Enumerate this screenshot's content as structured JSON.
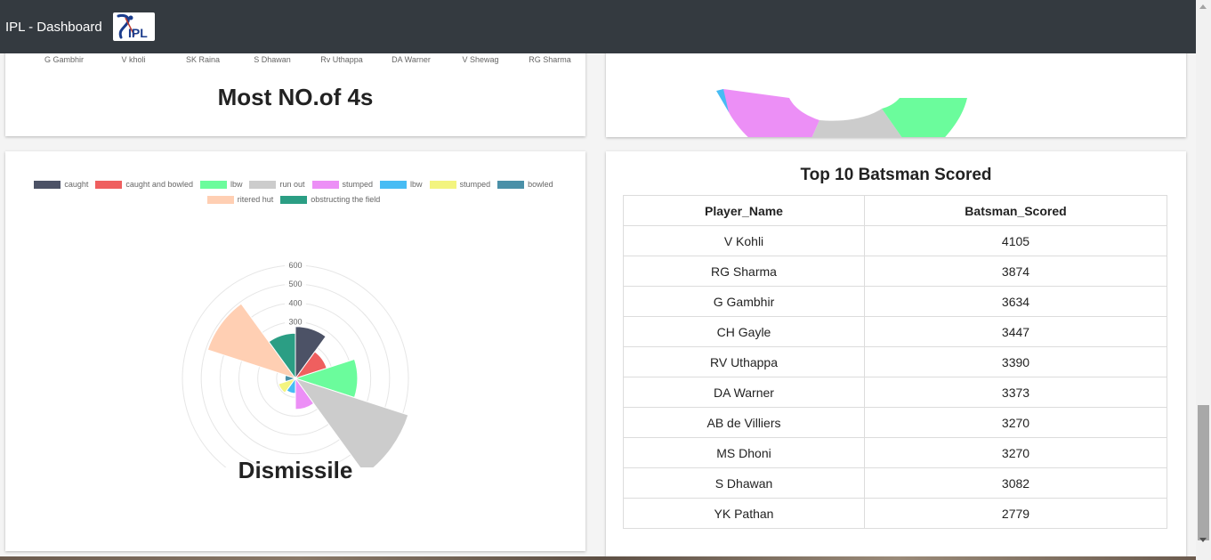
{
  "header": {
    "title": "IPL - Dashboard",
    "logo_text": "IPL"
  },
  "fours_card": {
    "x_labels": [
      "G Gambhir",
      "V kholi",
      "SK Raina",
      "S Dhawan",
      "Rv Uthappa",
      "DA Warner",
      "V Shewag",
      "RG Sharma"
    ],
    "title": "Most NO.of 4s"
  },
  "dismissal_card": {
    "title": "Dismissile",
    "chart_data": {
      "type": "polarArea",
      "categories": [
        "caught",
        "caught and bowled",
        "lbw",
        "run out",
        "stumped",
        "lbw",
        "stumped",
        "bowled",
        "ritered hut",
        "obstructing the field"
      ],
      "values": [
        275,
        175,
        330,
        630,
        165,
        80,
        95,
        55,
        490,
        240
      ],
      "colors": [
        "#4c5266",
        "#ef5f5f",
        "#6bfc9c",
        "#cccccc",
        "#ec8ff6",
        "#47bcf4",
        "#f3f47f",
        "#4a90a8",
        "#ffcfb3",
        "#2b9e84"
      ],
      "radial_ticks": [
        100,
        200,
        300,
        400,
        500,
        600
      ],
      "r_max": 600,
      "legend_position": "top"
    }
  },
  "batsman_table": {
    "title": "Top 10 Batsman Scored",
    "columns": [
      "Player_Name",
      "Batsman_Scored"
    ],
    "rows": [
      [
        "V Kohli",
        "4105"
      ],
      [
        "RG Sharma",
        "3874"
      ],
      [
        "G Gambhir",
        "3634"
      ],
      [
        "CH Gayle",
        "3447"
      ],
      [
        "RV Uthappa",
        "3390"
      ],
      [
        "DA Warner",
        "3373"
      ],
      [
        "AB de Villiers",
        "3270"
      ],
      [
        "MS Dhoni",
        "3270"
      ],
      [
        "S Dhawan",
        "3082"
      ],
      [
        "YK Pathan",
        "2779"
      ]
    ]
  }
}
